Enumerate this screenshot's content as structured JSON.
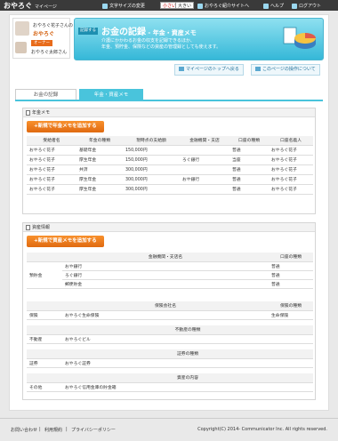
{
  "topbar": {
    "brand": "おやろぐ",
    "brand_sub": "マイページ",
    "font_size_label": "文字サイズの変更",
    "font_small": "小さい",
    "font_large": "大きい",
    "site_link": "おやろぐ紹介サイトへ",
    "help": "ヘルプ",
    "logout": "ログアウト"
  },
  "user": {
    "viewer_line": "おやろぐ花子さんの",
    "viewer_name": "おやろぐ",
    "owner_badge": "オーナー",
    "owner_name": "おやろぐ太郎さん"
  },
  "hero": {
    "badge": "記録する",
    "title": "お金の記録",
    "subtitle": " - 年金・資産メモ",
    "desc_lines": [
      "介護にかかわるお金の収支を記録できるほか、",
      "年金、預貯金、保険などの資産の管理録としても使えます。"
    ]
  },
  "nav": {
    "top": "マイページのトップへ戻る",
    "about": "このページの操作について"
  },
  "tabs": {
    "money_record": "お金の記録",
    "pension_memo": "年金・資産メモ"
  },
  "pension": {
    "section_title": "年金メモ",
    "add_button": "+新規で年金メモを追加する",
    "headers": [
      "受給者名",
      "年金の種類",
      "現時点の支給額",
      "金融機関・支店",
      "口座の種類",
      "口座名義人"
    ],
    "rows": [
      [
        "おやろぐ花子",
        "基礎年金",
        "150,000円",
        "",
        "普通",
        "おやろぐ花子"
      ],
      [
        "おやろぐ花子",
        "厚生年金",
        "150,000円",
        "ろぐ銀行",
        "当座",
        "おやろぐ花子"
      ],
      [
        "おやろぐ花子",
        "共済",
        "300,000円",
        "",
        "普通",
        "おやろぐ花子"
      ],
      [
        "おやろぐ花子",
        "厚生年金",
        "300,000円",
        "おや銀行",
        "普通",
        "おやろぐ花子"
      ],
      [
        "おやろぐ花子",
        "厚生年金",
        "300,000円",
        "",
        "普通",
        "おやろぐ花子"
      ]
    ]
  },
  "assets": {
    "section_title": "資産情報",
    "add_button": "+新規で資産メモを追加する",
    "savings": {
      "category": "預貯金",
      "header_bank": "金融機関・支店名",
      "header_type": "口座の種類",
      "rows": [
        [
          "おや銀行",
          "普通"
        ],
        [
          "ろぐ銀行",
          "普通"
        ],
        [
          "郵便貯金",
          "普通"
        ]
      ]
    },
    "insurance": {
      "category": "保険",
      "header_name": "保険会社名",
      "header_type": "保険の種類",
      "row": [
        "おやろぐ生命保険",
        "生命保険"
      ]
    },
    "realestate": {
      "category": "不動産",
      "header": "不動産の種類",
      "value": "おやろぐビル"
    },
    "securities": {
      "category": "証券",
      "header": "証券の種類",
      "value": "おやろぐ証券"
    },
    "other": {
      "category": "その他",
      "header": "資産の内容",
      "value": "おやろぐ信用金庫の貯金箱"
    }
  },
  "footer": {
    "contact": "お問い合わせ",
    "terms": "利用規約",
    "privacy": "プライバシーポリシー",
    "copyright": "Copyright(C) 2014- Communicator Inc. All rights reserved."
  }
}
